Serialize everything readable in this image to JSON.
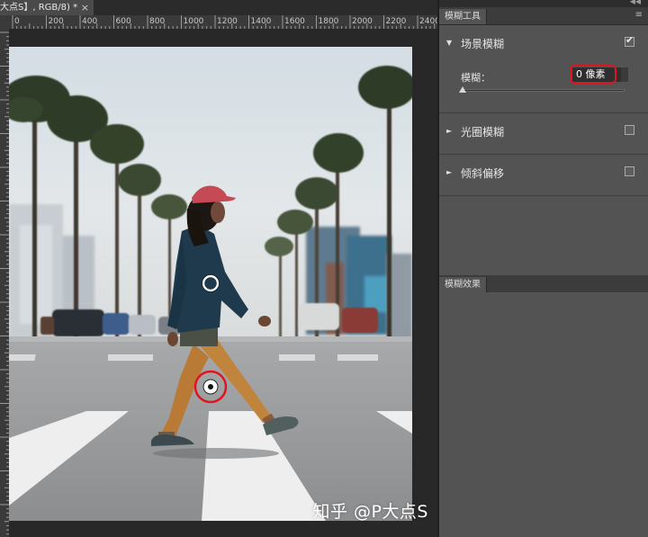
{
  "document": {
    "tab_title": "大点S】, RGB/8) *",
    "close_glyph": "×"
  },
  "ruler": {
    "labels": [
      "0",
      "200",
      "400",
      "600",
      "800",
      "1000",
      "1200",
      "1400",
      "1600",
      "1800",
      "2000",
      "2200",
      "2400"
    ]
  },
  "blur_tools_panel": {
    "tab_label": "模糊工具",
    "menu_icon": "panel-menu-icon",
    "sections": [
      {
        "title": "场景模糊",
        "expanded": true,
        "checked": true
      },
      {
        "title": "光圈模糊",
        "expanded": false,
        "checked": false
      },
      {
        "title": "倾斜偏移",
        "expanded": false,
        "checked": false
      }
    ],
    "blur_label": "模糊：",
    "blur_value": "0 像素",
    "blur_slider_fraction": 0.0
  },
  "blur_effects_panel": {
    "tab_label": "模糊效果"
  },
  "watermark": "知乎 @P大点S",
  "colors": {
    "highlight": "#e0141c",
    "panel_bg": "#535353",
    "workspace_bg": "#282828"
  },
  "icons": {
    "expanded": "▼",
    "collapsed": "►",
    "collapse_panel": "◀◀",
    "menu": "≡"
  }
}
